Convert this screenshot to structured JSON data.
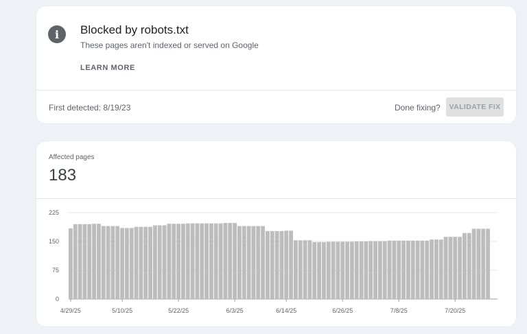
{
  "issue": {
    "title": "Blocked by robots.txt",
    "subtitle": "These pages aren't indexed or served on Google",
    "learn_more": "LEARN MORE",
    "first_detected": "First detected: 8/19/23",
    "done_fixing": "Done fixing?",
    "validate_fix": "VALIDATE FIX",
    "icon": "info-icon"
  },
  "affected": {
    "label": "Affected pages",
    "count": "183"
  },
  "chart_data": {
    "type": "bar",
    "title": "",
    "xlabel": "",
    "ylabel": "",
    "ylim": [
      0,
      225
    ],
    "yticks": [
      0,
      75,
      150,
      225
    ],
    "x_tick_labels": [
      "4/29/25",
      "5/10/25",
      "5/22/25",
      "6/3/25",
      "6/14/25",
      "6/26/25",
      "7/8/25",
      "7/20/25"
    ],
    "x_tick_indices": [
      0,
      11,
      23,
      35,
      46,
      58,
      70,
      82
    ],
    "grid": true,
    "bar_color": "#bdbdbd",
    "values": [
      184,
      195,
      195,
      195,
      195,
      196,
      196,
      190,
      190,
      190,
      190,
      185,
      185,
      185,
      188,
      188,
      188,
      188,
      192,
      192,
      192,
      196,
      196,
      196,
      196,
      197,
      197,
      197,
      197,
      197,
      197,
      197,
      197,
      198,
      198,
      198,
      190,
      190,
      190,
      190,
      190,
      190,
      177,
      177,
      177,
      177,
      178,
      178,
      153,
      153,
      153,
      153,
      148,
      148,
      148,
      149,
      149,
      149,
      149,
      149,
      149,
      150,
      150,
      150,
      151,
      151,
      151,
      151,
      152,
      152,
      152,
      152,
      152,
      152,
      152,
      152,
      152,
      155,
      155,
      155,
      162,
      162,
      162,
      162,
      172,
      172,
      183,
      183,
      183,
      183
    ]
  }
}
